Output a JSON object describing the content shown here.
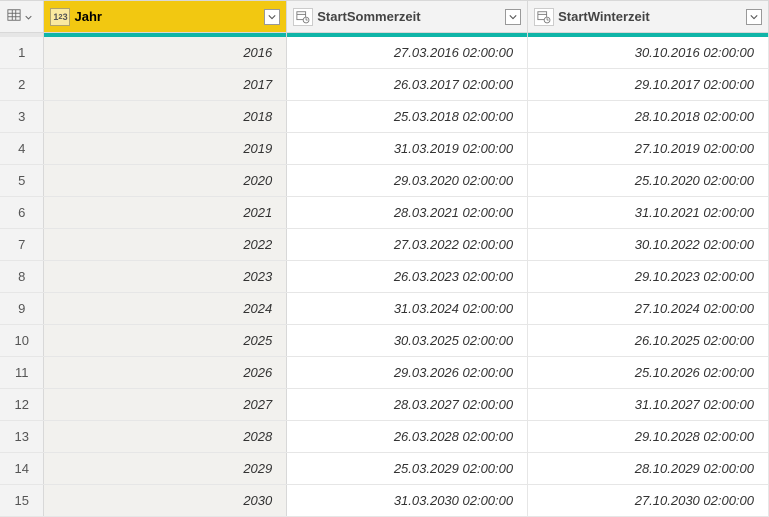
{
  "columns": {
    "jahr": {
      "label": "Jahr",
      "type": "number"
    },
    "sommer": {
      "label": "StartSommerzeit",
      "type": "datetime"
    },
    "winter": {
      "label": "StartWinterzeit",
      "type": "datetime"
    }
  },
  "rows": [
    {
      "n": "1",
      "jahr": "2016",
      "sommer": "27.03.2016 02:00:00",
      "winter": "30.10.2016 02:00:00"
    },
    {
      "n": "2",
      "jahr": "2017",
      "sommer": "26.03.2017 02:00:00",
      "winter": "29.10.2017 02:00:00"
    },
    {
      "n": "3",
      "jahr": "2018",
      "sommer": "25.03.2018 02:00:00",
      "winter": "28.10.2018 02:00:00"
    },
    {
      "n": "4",
      "jahr": "2019",
      "sommer": "31.03.2019 02:00:00",
      "winter": "27.10.2019 02:00:00"
    },
    {
      "n": "5",
      "jahr": "2020",
      "sommer": "29.03.2020 02:00:00",
      "winter": "25.10.2020 02:00:00"
    },
    {
      "n": "6",
      "jahr": "2021",
      "sommer": "28.03.2021 02:00:00",
      "winter": "31.10.2021 02:00:00"
    },
    {
      "n": "7",
      "jahr": "2022",
      "sommer": "27.03.2022 02:00:00",
      "winter": "30.10.2022 02:00:00"
    },
    {
      "n": "8",
      "jahr": "2023",
      "sommer": "26.03.2023 02:00:00",
      "winter": "29.10.2023 02:00:00"
    },
    {
      "n": "9",
      "jahr": "2024",
      "sommer": "31.03.2024 02:00:00",
      "winter": "27.10.2024 02:00:00"
    },
    {
      "n": "10",
      "jahr": "2025",
      "sommer": "30.03.2025 02:00:00",
      "winter": "26.10.2025 02:00:00"
    },
    {
      "n": "11",
      "jahr": "2026",
      "sommer": "29.03.2026 02:00:00",
      "winter": "25.10.2026 02:00:00"
    },
    {
      "n": "12",
      "jahr": "2027",
      "sommer": "28.03.2027 02:00:00",
      "winter": "31.10.2027 02:00:00"
    },
    {
      "n": "13",
      "jahr": "2028",
      "sommer": "26.03.2028 02:00:00",
      "winter": "29.10.2028 02:00:00"
    },
    {
      "n": "14",
      "jahr": "2029",
      "sommer": "25.03.2029 02:00:00",
      "winter": "28.10.2029 02:00:00"
    },
    {
      "n": "15",
      "jahr": "2030",
      "sommer": "31.03.2030 02:00:00",
      "winter": "27.10.2030 02:00:00"
    }
  ]
}
